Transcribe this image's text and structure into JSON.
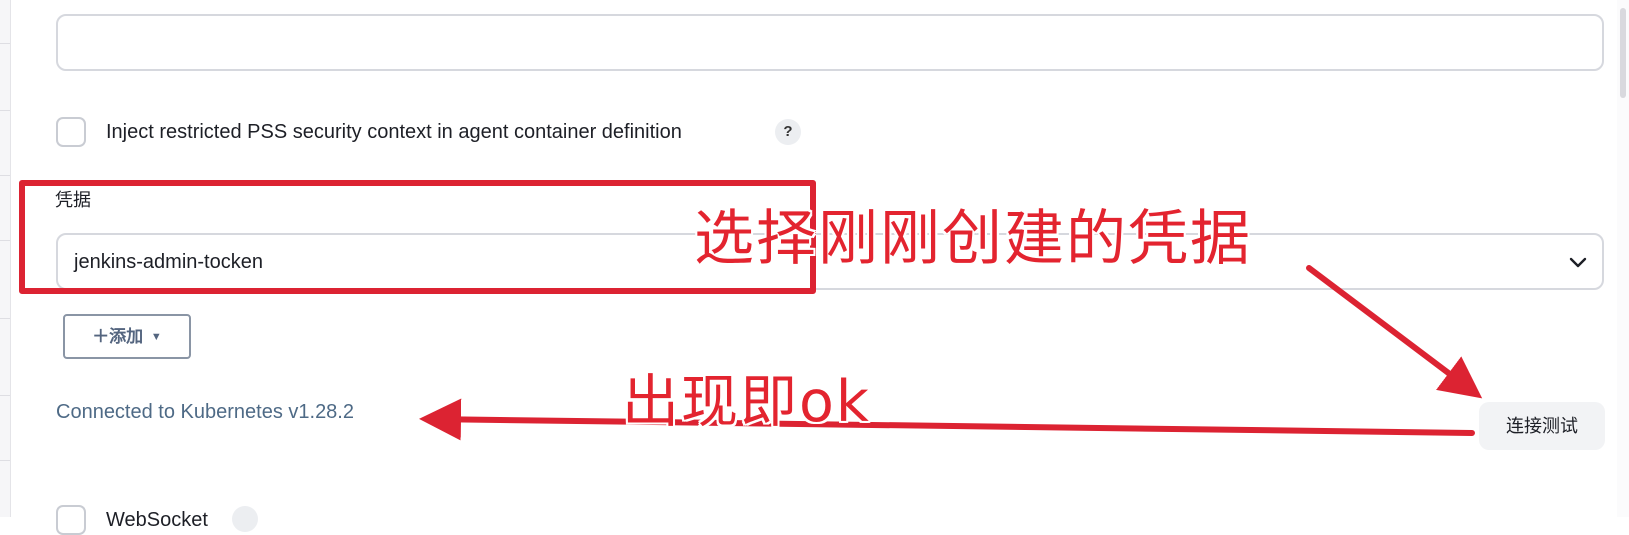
{
  "inject_pss": {
    "label": "Inject restricted PSS security context in agent container definition",
    "help": "?"
  },
  "credentials": {
    "label": "凭据",
    "selected": "jenkins-admin-tocken",
    "add_button": "＋添加"
  },
  "connection": {
    "status": "Connected to Kubernetes v1.28.2",
    "test_button": "连接测试"
  },
  "bottom_row": {
    "label": "WebSocket"
  },
  "annotations": {
    "select_hint": "选择刚刚创建的凭据",
    "ok_hint": "出现即ok"
  },
  "colors": {
    "annotation_red": "#dc2332",
    "link_blue": "#4e6a86"
  }
}
